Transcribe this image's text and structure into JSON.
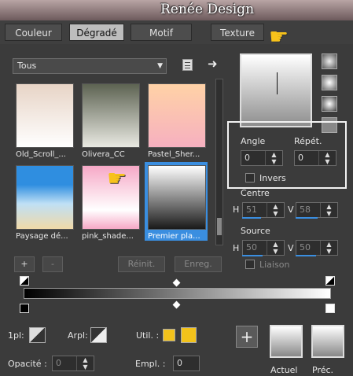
{
  "banner": {
    "title": "Renée Design"
  },
  "tabs": [
    {
      "label": "Couleur",
      "active": false
    },
    {
      "label": "Dégradé",
      "active": true
    },
    {
      "label": "Motif",
      "active": false
    },
    {
      "label": "Texture",
      "active": false
    }
  ],
  "category": {
    "value": "Tous"
  },
  "gradients": [
    {
      "label": "Old_Scroll_...",
      "top": "#e7d4c6",
      "bottom": "#ffffff",
      "selected": false
    },
    {
      "label": "Olivera_CC",
      "top": "#5d6352",
      "bottom": "#e9e9e2",
      "selected": false
    },
    {
      "label": "Pastel_Sher...",
      "top": "#ffd2a6",
      "bottom": "#f6b0c0",
      "selected": false
    },
    {
      "label": "Paysage dé...",
      "top": "#2f8ee0",
      "bottom": "#f0d9a8",
      "selected": false
    },
    {
      "label": "pink_shade...",
      "top": "#f6a8c6",
      "bottom": "#ffffff",
      "selected": false
    },
    {
      "label": "Premier pla...",
      "top": "#ffffff",
      "bottom": "#1a1a1a",
      "selected": true
    }
  ],
  "list_buttons": {
    "add": "+",
    "remove": "-",
    "reset": "Réinit.",
    "save": "Enreg."
  },
  "angle": {
    "label": "Angle",
    "value": "0"
  },
  "repeat": {
    "label": "Répét.",
    "value": "0"
  },
  "invert": {
    "label": "Invers",
    "checked": false
  },
  "centre": {
    "label": "Centre",
    "h_label": "H",
    "h_value": "51",
    "v_label": "V",
    "v_value": "58"
  },
  "source": {
    "label": "Source",
    "h_label": "H",
    "h_value": "50",
    "v_label": "V",
    "v_value": "50"
  },
  "link": {
    "label": "Liaison",
    "checked": false
  },
  "bottom": {
    "pl_label": "1pl:",
    "arpl_label": "Arpl:",
    "util_label": "Util. :",
    "util_color": "#f2c21b",
    "opacity_label": "Opacité :",
    "opacity_value": "0",
    "empl_label": "Empl. :",
    "empl_value": "0",
    "current_label": "Actuel",
    "previous_label": "Préc."
  },
  "icons": {
    "arrow": "right-arrow-icon",
    "doc": "document-icon",
    "plus": "plus-icon"
  }
}
